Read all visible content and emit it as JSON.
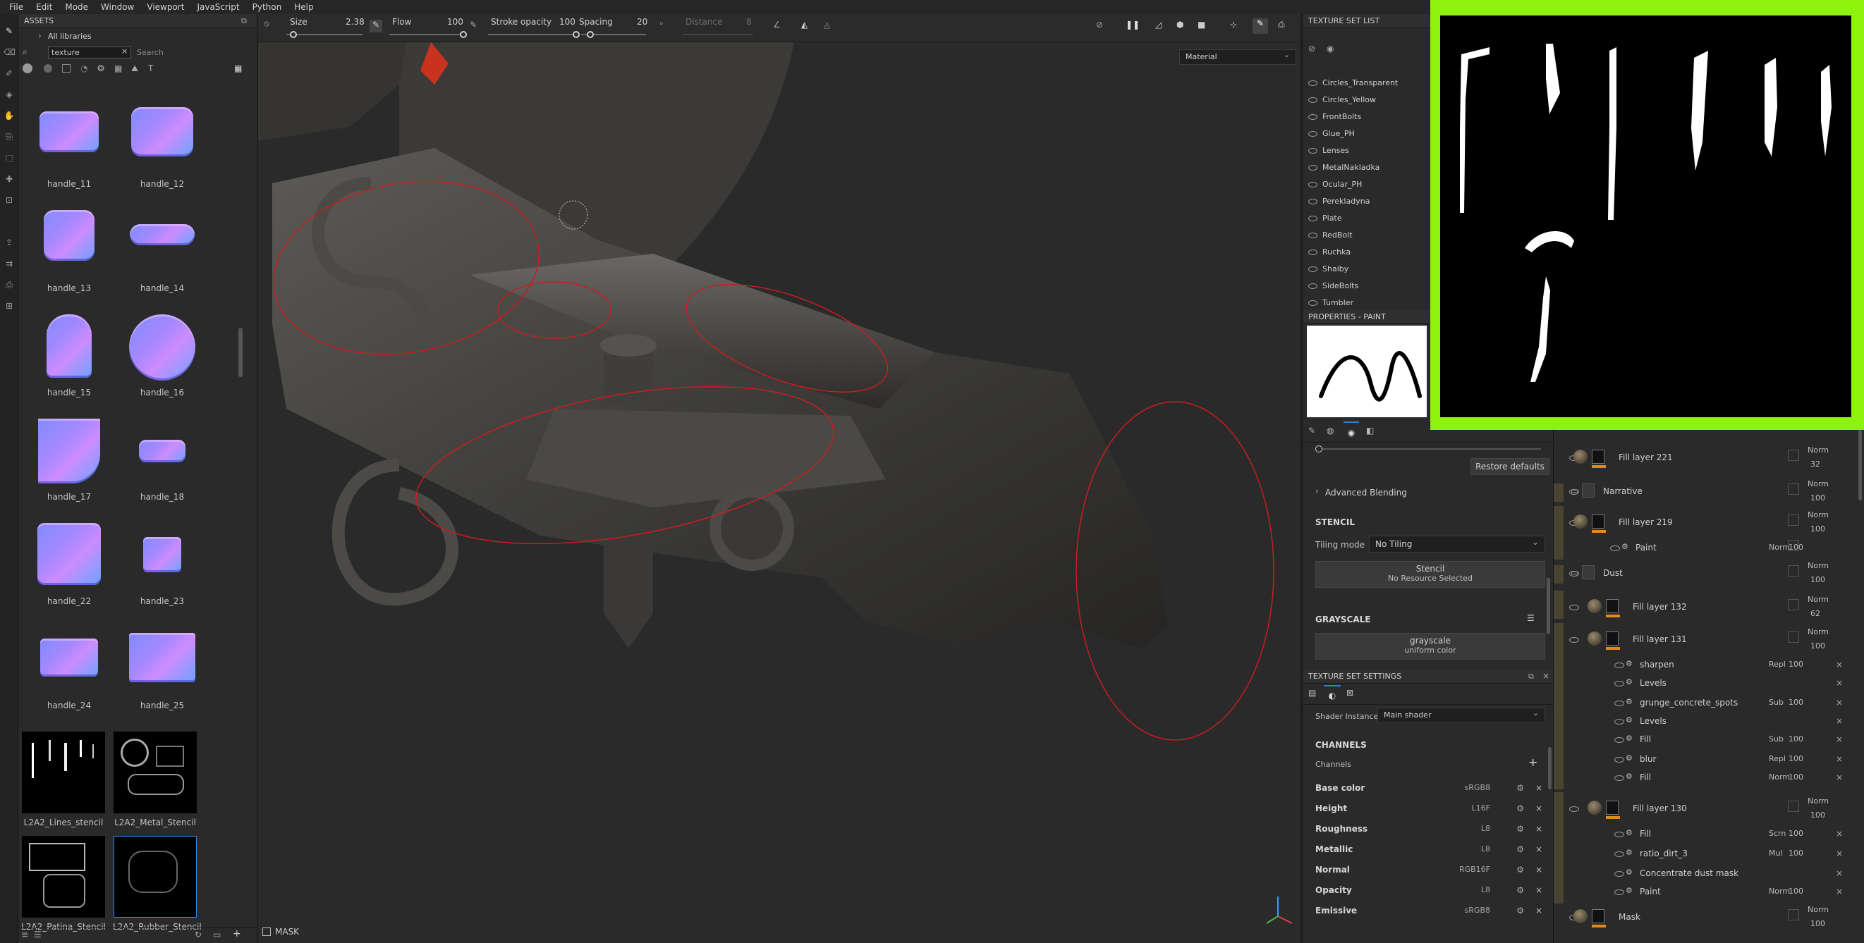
{
  "menu": [
    "File",
    "Edit",
    "Mode",
    "Window",
    "Viewport",
    "JavaScript",
    "Python",
    "Help"
  ],
  "toolbar": {
    "size_label": "Size",
    "size_value": "2.38",
    "flow_label": "Flow",
    "flow_value": "100",
    "stroke_label": "Stroke opacity",
    "stroke_value": "100",
    "spacing_label": "Spacing",
    "spacing_value": "20",
    "distance_label": "Distance",
    "distance_value": "8",
    "size_fraction": 0.05,
    "flow_fraction": 1.0,
    "stroke_fraction": 1.0,
    "spacing_fraction": 0.1
  },
  "assets": {
    "title": "ASSETS",
    "breadcrumb": "All libraries",
    "search_value": "texture",
    "search_placeholder": "Search",
    "items": [
      {
        "label": "handle_11"
      },
      {
        "label": "handle_12"
      },
      {
        "label": "handle_13"
      },
      {
        "label": "handle_14"
      },
      {
        "label": "handle_15"
      },
      {
        "label": "handle_16"
      },
      {
        "label": "handle_17"
      },
      {
        "label": "handle_18"
      },
      {
        "label": "handle_22"
      },
      {
        "label": "handle_23"
      },
      {
        "label": "handle_24"
      },
      {
        "label": "handle_25"
      },
      {
        "label": "L2A2_Lines_stencil"
      },
      {
        "label": "L2A2_Metal_Stencil"
      },
      {
        "label": "L2A2_Patina_Stencil"
      },
      {
        "label": "L2A2_Rubber_Stencil"
      }
    ]
  },
  "viewport": {
    "material_mode": "Material",
    "bottom_label": "MASK"
  },
  "texture_set_list": {
    "title": "TEXTURE SET LIST",
    "items": [
      "Circles_Transparent",
      "Circles_Yellow",
      "FrontBolts",
      "Glue_PH",
      "Lenses",
      "MetalNakladka",
      "Ocular_PH",
      "Perekladyna",
      "Plate",
      "RedBolt",
      "Ruchka",
      "Shaiby",
      "SideBolts",
      "Tumbler"
    ]
  },
  "properties": {
    "title": "PROPERTIES - PAINT",
    "restore": "Restore defaults",
    "advanced": "Advanced Blending",
    "stencil_header": "STENCIL",
    "tiling_label": "Tiling mode",
    "tiling_value": "No Tiling",
    "stencil_name": "Stencil",
    "stencil_resource": "No Resource Selected",
    "grayscale_header": "GRAYSCALE",
    "grayscale_name": "grayscale",
    "grayscale_sub": "uniform color"
  },
  "texture_set_settings": {
    "title": "TEXTURE SET SETTINGS",
    "shader_label": "Shader Instance",
    "shader_value": "Main shader",
    "channels_header": "CHANNELS",
    "channels_label": "Channels",
    "channels": [
      {
        "name": "Base color",
        "format": "sRGB8"
      },
      {
        "name": "Height",
        "format": "L16F"
      },
      {
        "name": "Roughness",
        "format": "L8"
      },
      {
        "name": "Metallic",
        "format": "L8"
      },
      {
        "name": "Normal",
        "format": "RGB16F"
      },
      {
        "name": "Opacity",
        "format": "L8"
      },
      {
        "name": "Emissive",
        "format": "sRGB8"
      }
    ]
  },
  "layers": {
    "rows": [
      {
        "name": "Fill layer 221",
        "blend": "Norm",
        "opacity": "32"
      },
      {
        "name": "Narrative",
        "blend": "Norm",
        "opacity": "100"
      },
      {
        "name": "Fill layer 219",
        "blend": "Norm",
        "opacity": "100"
      },
      {
        "name": "Paint",
        "blend": "Norm",
        "opacity": "100"
      },
      {
        "name": "Dust",
        "blend": "Norm",
        "opacity": "100"
      },
      {
        "name": "Fill layer 132",
        "blend": "Norm",
        "opacity": "62"
      },
      {
        "name": "Fill layer 131",
        "blend": "Norm",
        "opacity": "100"
      },
      {
        "name": "sharpen",
        "blend": "Repl",
        "opacity": "100"
      },
      {
        "name": "Levels",
        "blend": "",
        "opacity": ""
      },
      {
        "name": "grunge_concrete_spots",
        "blend": "Sub",
        "opacity": "100"
      },
      {
        "name": "Levels",
        "blend": "",
        "opacity": ""
      },
      {
        "name": "Fill",
        "blend": "Sub",
        "opacity": "100"
      },
      {
        "name": "blur",
        "blend": "Repl",
        "opacity": "100"
      },
      {
        "name": "Fill",
        "blend": "Norm",
        "opacity": "100"
      },
      {
        "name": "Fill layer 130",
        "blend": "Norm",
        "opacity": "100"
      },
      {
        "name": "Fill",
        "blend": "Scrn",
        "opacity": "100"
      },
      {
        "name": "ratio_dirt_3",
        "blend": "Mul",
        "opacity": "100"
      },
      {
        "name": "Concentrate dust mask",
        "blend": "",
        "opacity": ""
      },
      {
        "name": "Paint",
        "blend": "Norm",
        "opacity": "100"
      },
      {
        "name": "Mask",
        "blend": "Norm",
        "opacity": "100"
      }
    ]
  },
  "colors": {
    "accent": "#2f7fd8",
    "preview_border": "#8ef20f",
    "orange": "#e08a1e",
    "stroke": "#c81e1e"
  }
}
